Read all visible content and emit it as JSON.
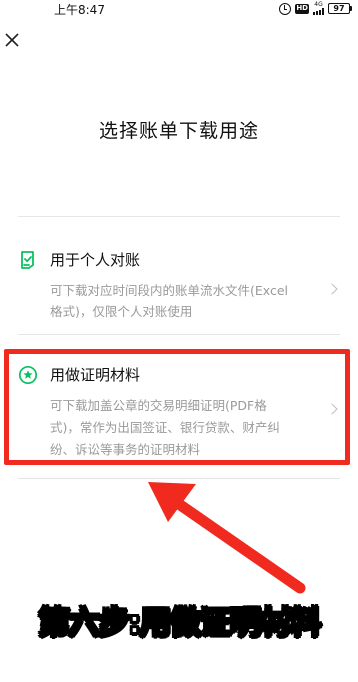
{
  "status_bar": {
    "time": "上午8:47",
    "hd_label": "HD",
    "network": "4G",
    "battery": "97"
  },
  "page": {
    "title": "选择账单下载用途"
  },
  "options": [
    {
      "title": "用于个人对账",
      "desc_line1": "可下载对应时间段内的账单流水文件(Excel",
      "desc_line2": "格式)，仅限个人对账使用",
      "icon": "document-check-icon"
    },
    {
      "title": "用做证明材料",
      "desc_line1": "可下载加盖公章的交易明细证明(PDF格",
      "desc_line2": "式)，常作为出国签证、银行贷款、财产纠",
      "desc_line3": "纷、诉讼等事务的证明材料",
      "icon": "star-badge-icon"
    }
  ],
  "annotation": {
    "caption": "第六步:用做证明材料",
    "highlight_color": "#f02a1f"
  },
  "colors": {
    "accent": "#07c160",
    "text_secondary": "#9a9a9a"
  }
}
